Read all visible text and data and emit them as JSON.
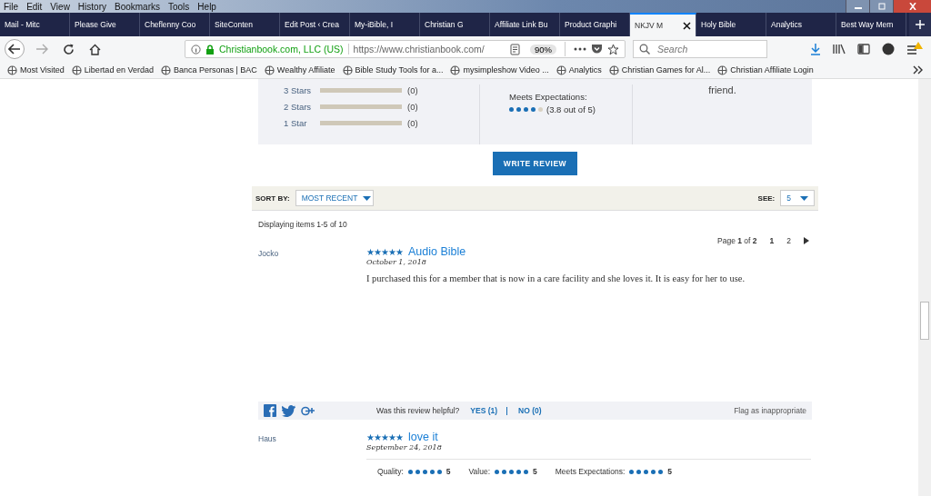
{
  "menu": [
    "File",
    "Edit",
    "View",
    "History",
    "Bookmarks",
    "Tools",
    "Help"
  ],
  "tabs": [
    {
      "label": "Mail - Mitc",
      "selected": false
    },
    {
      "label": "Please Give",
      "selected": false
    },
    {
      "label": "Cheflenny Coo",
      "selected": false
    },
    {
      "label": "SiteConten",
      "selected": false
    },
    {
      "label": "Edit Post ‹ Crea",
      "selected": false
    },
    {
      "label": "My-iBible, I",
      "selected": false
    },
    {
      "label": "Christian G",
      "selected": false
    },
    {
      "label": "Affiliate Link Bu",
      "selected": false
    },
    {
      "label": "Product Graphi",
      "selected": false
    },
    {
      "label": "NKJV M",
      "selected": true
    },
    {
      "label": "Holy Bible",
      "selected": false
    },
    {
      "label": "Analytics",
      "selected": false
    },
    {
      "label": "Best Way Mem",
      "selected": false
    }
  ],
  "address": {
    "identity": "Christianbook.com, LLC (US)",
    "url": "https://www.christianbook.com/",
    "zoom": "90%"
  },
  "search": {
    "placeholder": "Search"
  },
  "bookmarks": [
    "Most Visited",
    "Libertad en Verdad",
    "Banca Personas | BAC",
    "Wealthy Affiliate",
    "Bible Study Tools for a...",
    "mysimpleshow Video ...",
    "Analytics",
    "Christian Games for Al...",
    "Christian Affiliate Login"
  ],
  "summary": {
    "bars": [
      {
        "label": "3 Stars",
        "level": 0,
        "count": "(0)"
      },
      {
        "label": "2 Stars",
        "level": 0,
        "count": "(0)"
      },
      {
        "label": "1 Star",
        "level": 0,
        "count": "(0)"
      }
    ],
    "criterion": {
      "label": "Meets Expectations:",
      "stars": 4,
      "reading": "(3.8 out of 5)"
    },
    "recommend": "friend."
  },
  "write_review": "WRITE REVIEW",
  "sort": {
    "label": "SORT BY:",
    "value": "MOST RECENT",
    "see_label": "SEE:",
    "see_value": "5"
  },
  "displaying": "Displaying items 1-5 of 10",
  "pager": {
    "prefix": "Page",
    "current": "1",
    "middle": "of",
    "total": "2",
    "pages": [
      {
        "label": "1",
        "selected": true
      },
      {
        "label": "2",
        "selected": false
      }
    ]
  },
  "reviews": [
    {
      "author": "Jocko",
      "stars": 5,
      "title": "Audio Bible",
      "date": "October 1, 2018",
      "body": "I purchased this for a member that is now in a care facility and she loves it. It is easy for her to use.",
      "helpful": {
        "question": "Was this review helpful?",
        "yes": "YES (1)",
        "no": "NO (0)",
        "flag": "Flag as inappropriate"
      }
    },
    {
      "author": "Haus",
      "stars": 5,
      "title": "love it",
      "date": "September 24, 2018",
      "ratings": [
        {
          "label": "Quality:",
          "stars": 5,
          "value": "5"
        },
        {
          "label": "Value:",
          "stars": 5,
          "value": "5"
        },
        {
          "label": "Meets Expectations:",
          "stars": 5,
          "value": "5"
        }
      ]
    }
  ]
}
